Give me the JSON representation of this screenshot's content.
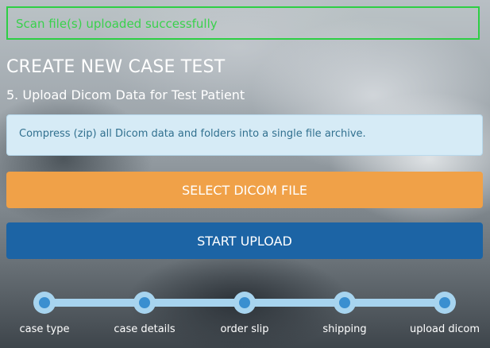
{
  "alert": {
    "text": "Scan file(s) uploaded successfully",
    "color": "#39d14c"
  },
  "page": {
    "title": "CREATE NEW CASE TEST",
    "subtitle": "5. Upload Dicom Data for Test Patient"
  },
  "info": {
    "text": "Compress (zip) all Dicom data and folders into a single file archive."
  },
  "buttons": {
    "select_label": "SELECT DICOM FILE",
    "select_color": "#f0a148",
    "upload_label": "START UPLOAD",
    "upload_color": "#1c64a5"
  },
  "steps": [
    {
      "label": "case type"
    },
    {
      "label": "case details"
    },
    {
      "label": "order slip"
    },
    {
      "label": "shipping"
    },
    {
      "label": "upload dicom"
    }
  ]
}
